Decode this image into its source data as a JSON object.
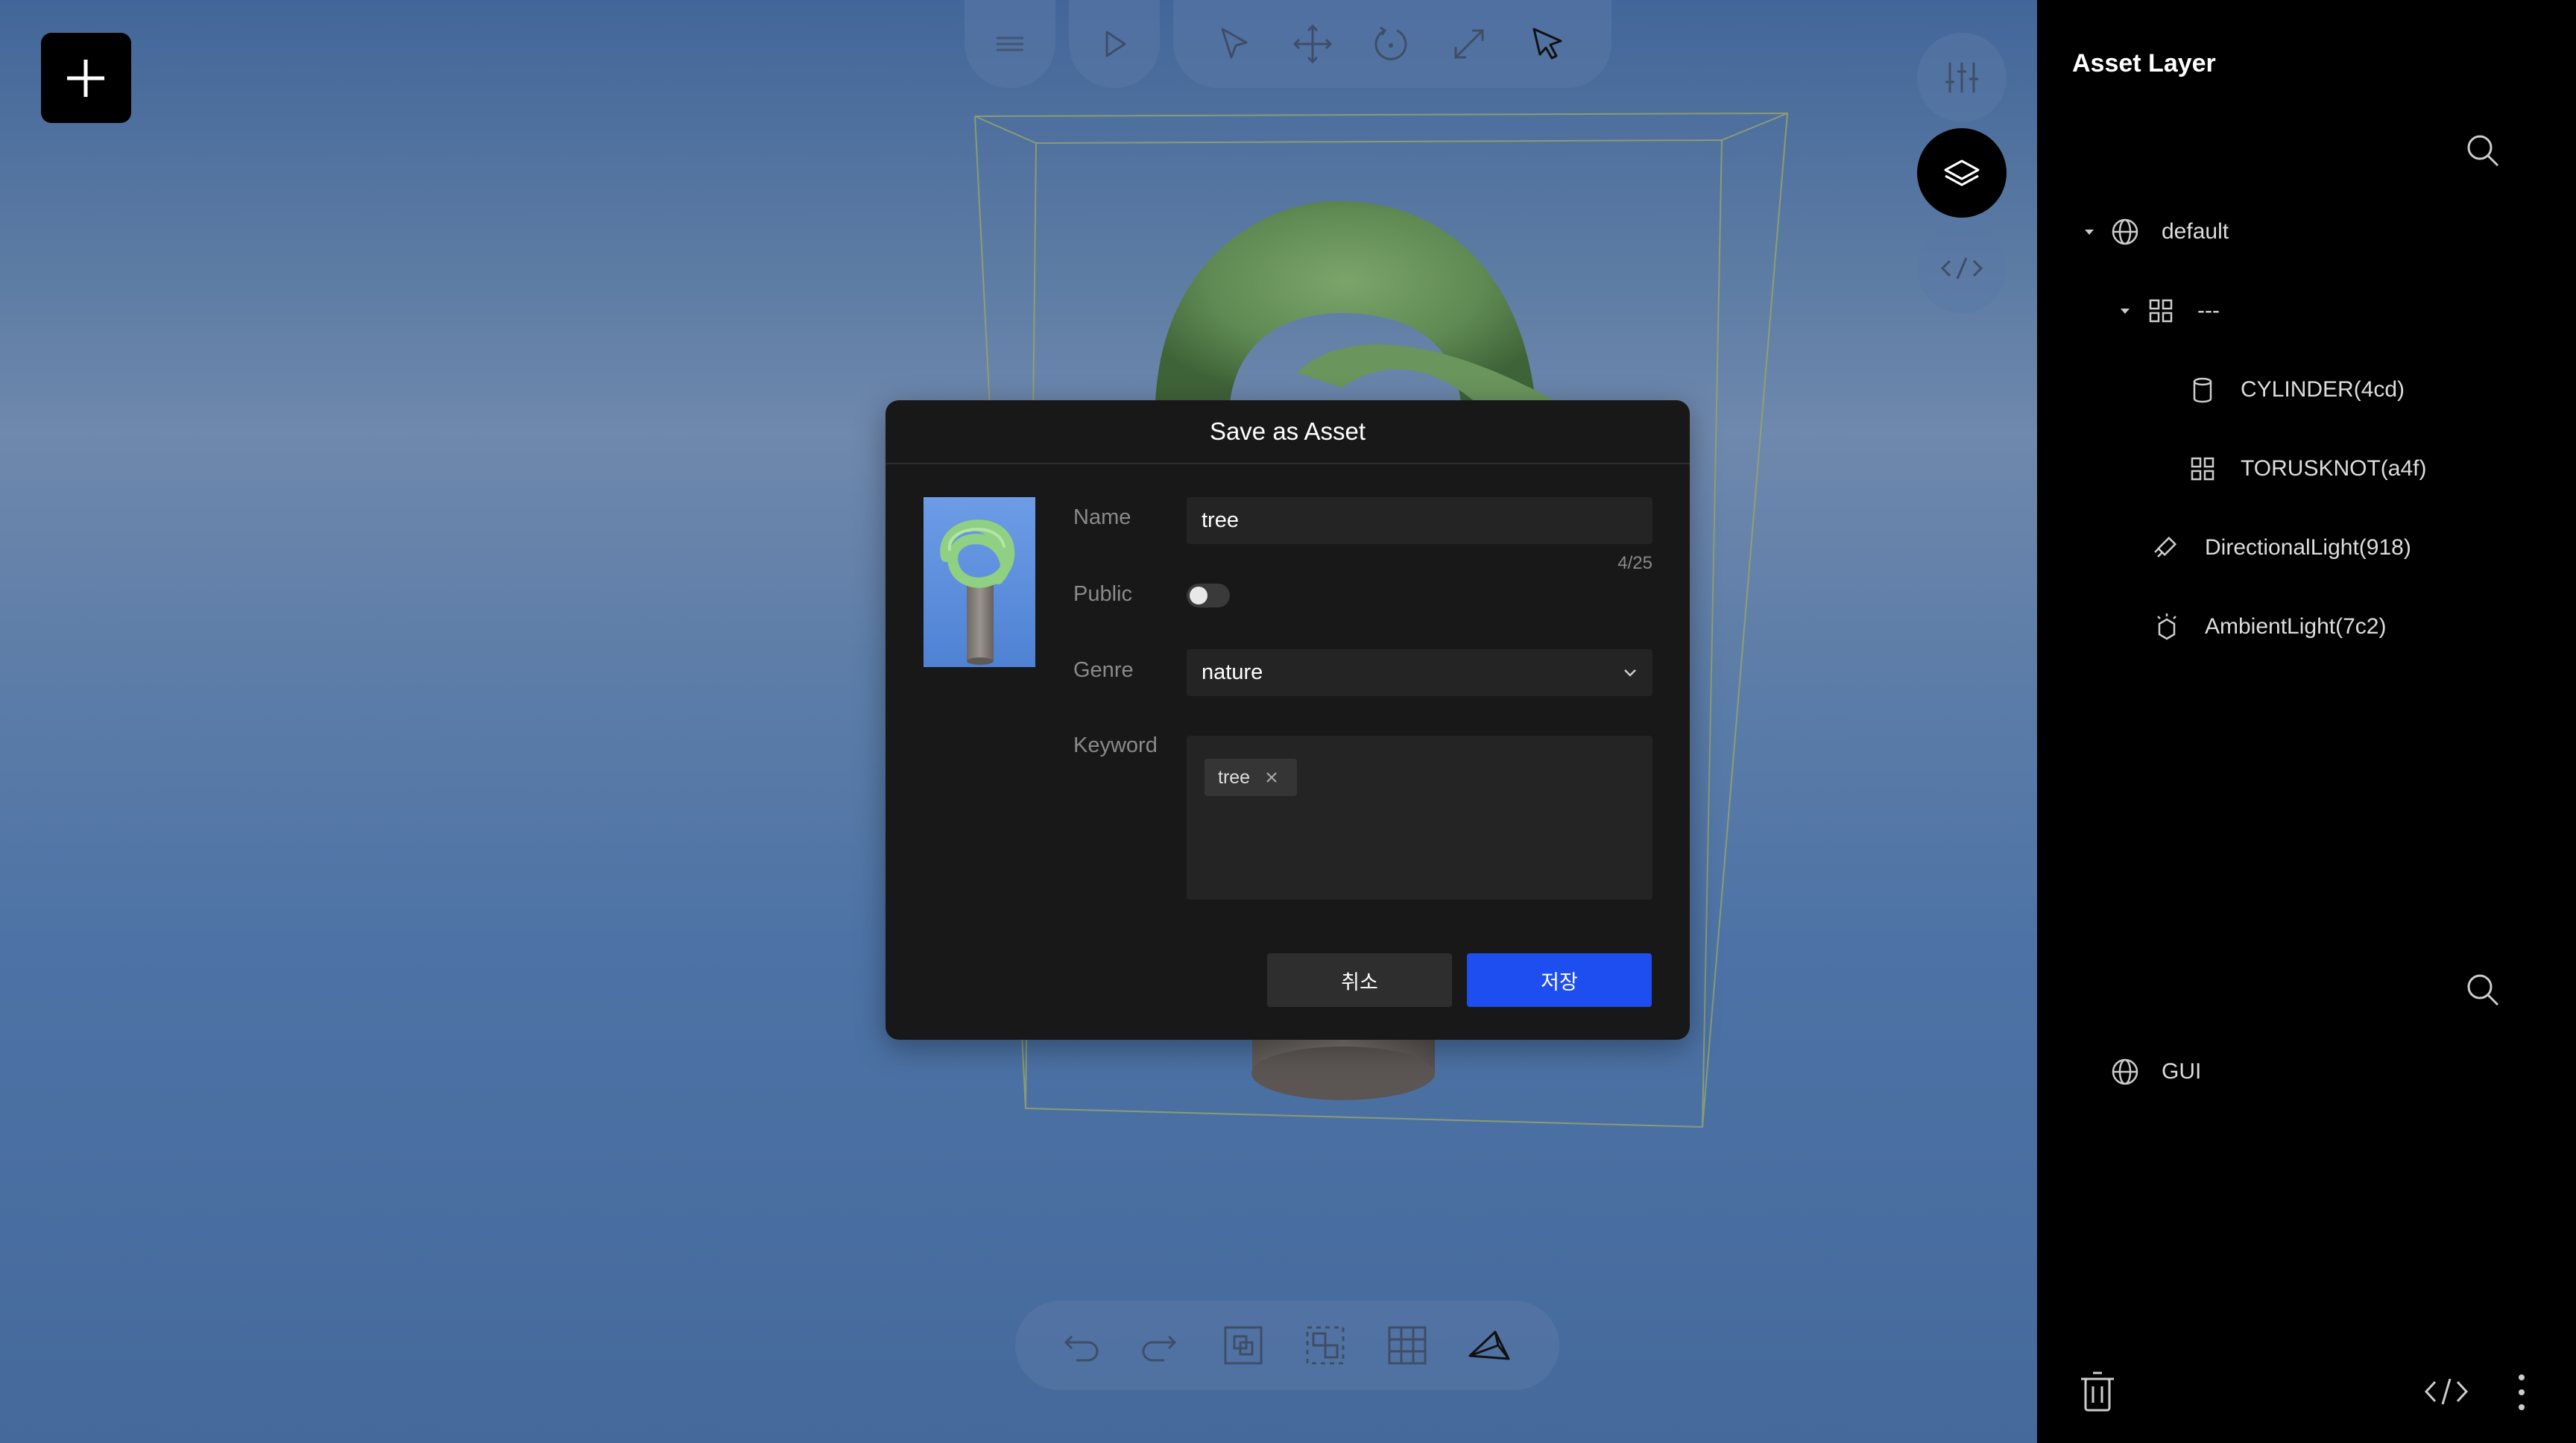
{
  "toolbar": {
    "menu_icon": "hamburger-icon",
    "play_icon": "play-icon",
    "tools": [
      "select-pointer-icon",
      "move-icon",
      "rotate-icon",
      "scale-icon",
      "pointer-active-icon"
    ]
  },
  "right_buttons": [
    "sliders-icon",
    "layers-icon",
    "code-icon"
  ],
  "bottom_toolbar": [
    "undo-icon",
    "redo-icon",
    "group-icon",
    "ungroup-icon",
    "grid-icon",
    "camera-icon"
  ],
  "dialog": {
    "title": "Save as Asset",
    "name_label": "Name",
    "name_value": "tree",
    "name_count": "4/25",
    "public_label": "Public",
    "public_on": false,
    "genre_label": "Genre",
    "genre_value": "nature",
    "keyword_label": "Keyword",
    "keywords": [
      "tree"
    ],
    "cancel_label": "취소",
    "save_label": "저장"
  },
  "sidebar": {
    "title": "Asset Layer",
    "tree": [
      {
        "label": "default",
        "icon": "globe-icon"
      },
      {
        "label": "---",
        "icon": "group-grid-icon"
      },
      {
        "label": "CYLINDER(4cd)",
        "icon": "cylinder-icon"
      },
      {
        "label": "TORUSKNOT(a4f)",
        "icon": "group-grid-icon"
      },
      {
        "label": "DirectionalLight(918)",
        "icon": "directional-light-icon"
      },
      {
        "label": "AmbientLight(7c2)",
        "icon": "ambient-light-icon"
      }
    ],
    "gui_tree": [
      {
        "label": "GUI",
        "icon": "globe-icon"
      }
    ]
  },
  "colors": {
    "accent": "#1f4ef0",
    "viewport_bg": "#4d73a6",
    "sidebar_bg": "#000000",
    "dialog_bg": "#181818"
  }
}
